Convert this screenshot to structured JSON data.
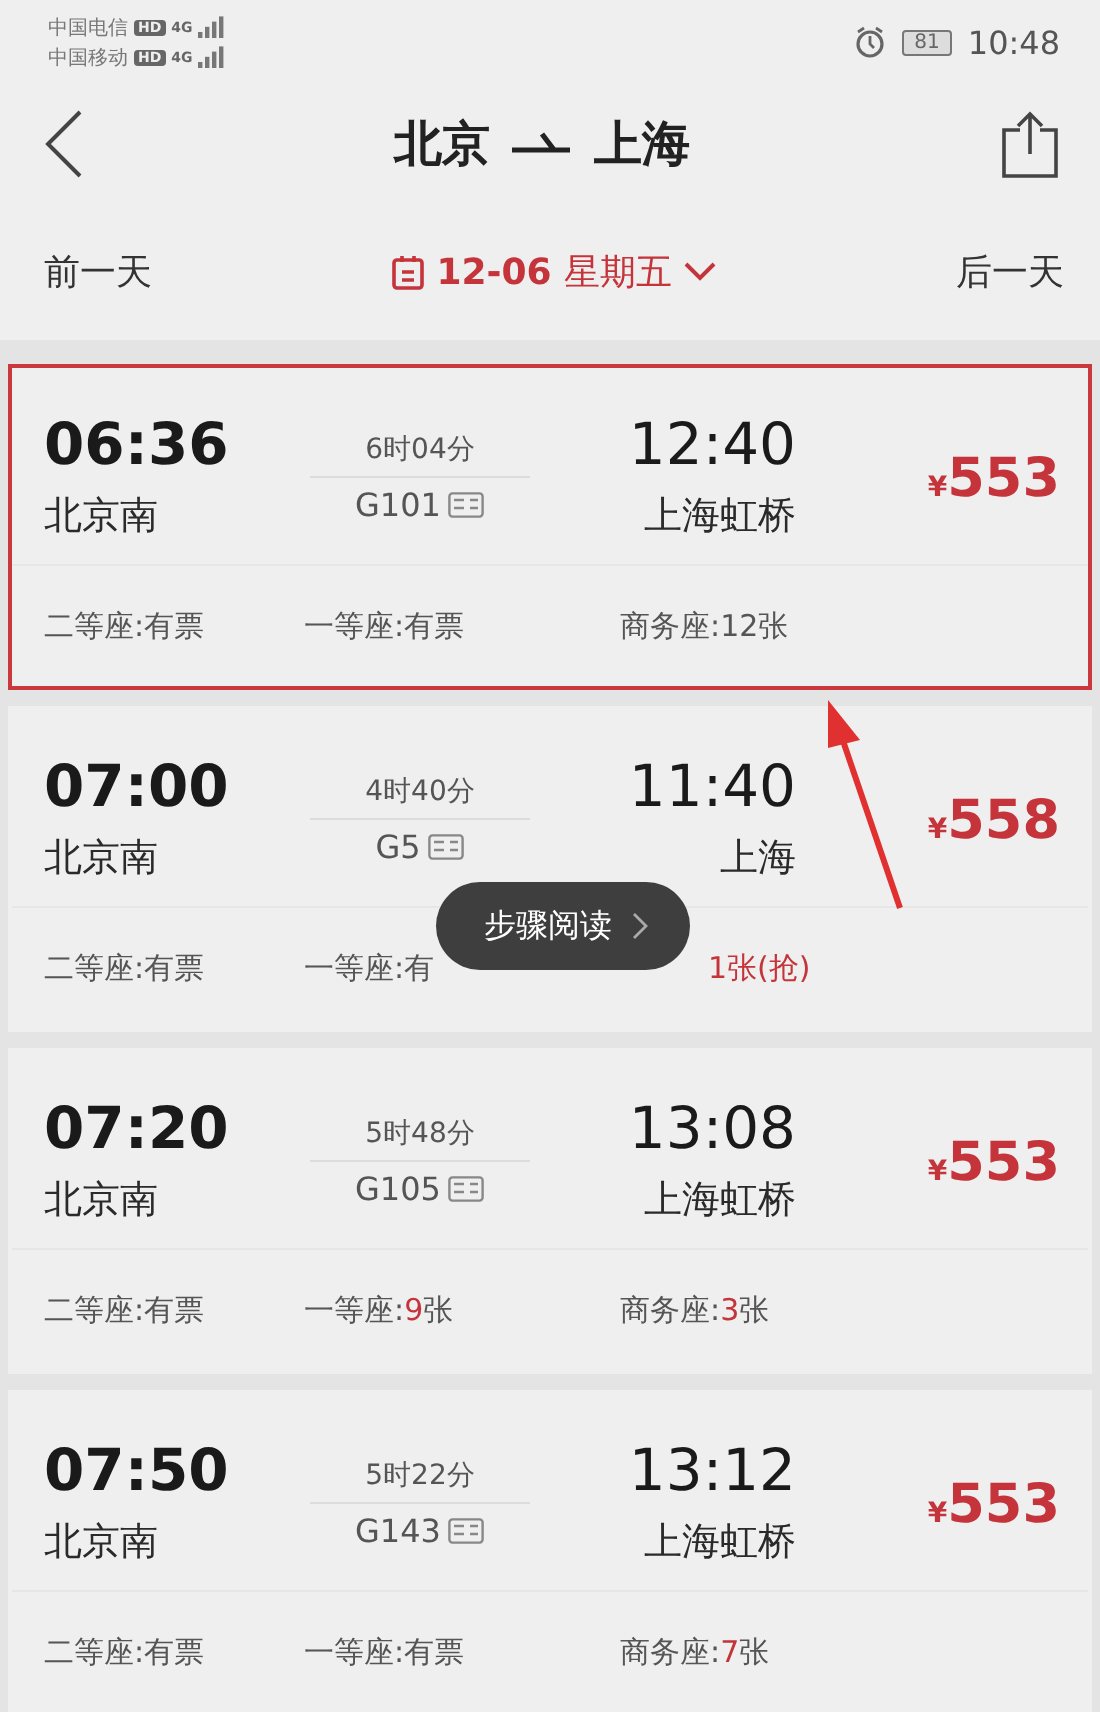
{
  "status_bar": {
    "carriers": [
      {
        "name": "中国电信",
        "badge": "HD",
        "network": "4G"
      },
      {
        "name": "中国移动",
        "badge": "HD",
        "network": "4G"
      }
    ],
    "battery": "81",
    "time": "10:48"
  },
  "header": {
    "from": "北京",
    "to": "上海"
  },
  "date_bar": {
    "prev": "前一天",
    "date": "12-06",
    "weekday": "星期五",
    "next": "后一天"
  },
  "trains": [
    {
      "depart": "06:36",
      "from": "北京南",
      "duration": "6时04分",
      "number": "G101",
      "arrive": "12:40",
      "to": "上海虹桥",
      "currency": "¥",
      "price": "553",
      "highlighted": true,
      "seats": [
        {
          "label": "二等座:",
          "count": "有票",
          "scarce": false
        },
        {
          "label": "一等座:",
          "count": "有票",
          "scarce": false
        },
        {
          "label": "商务座:",
          "count": "12张",
          "scarce": false
        }
      ]
    },
    {
      "depart": "07:00",
      "from": "北京南",
      "duration": "4时40分",
      "number": "G5",
      "arrive": "11:40",
      "to": "上海",
      "currency": "¥",
      "price": "558",
      "highlighted": false,
      "seats": [
        {
          "label": "二等座:",
          "count": "有票",
          "scarce": false
        },
        {
          "label": "一等座:有"
        },
        {
          "count": "1张(抢)",
          "scarce": true
        }
      ]
    },
    {
      "depart": "07:20",
      "from": "北京南",
      "duration": "5时48分",
      "number": "G105",
      "arrive": "13:08",
      "to": "上海虹桥",
      "currency": "¥",
      "price": "553",
      "highlighted": false,
      "seats": [
        {
          "label": "二等座:",
          "count": "有票",
          "scarce": false
        },
        {
          "label": "一等座:",
          "count": "9",
          "unit": "张",
          "scarce": true
        },
        {
          "label": "商务座:",
          "count": "3",
          "unit": "张",
          "scarce": true
        }
      ]
    },
    {
      "depart": "07:50",
      "from": "北京南",
      "duration": "5时22分",
      "number": "G143",
      "arrive": "13:12",
      "to": "上海虹桥",
      "currency": "¥",
      "price": "553",
      "highlighted": false,
      "seats": [
        {
          "label": "二等座:",
          "count": "有票",
          "scarce": false
        },
        {
          "label": "一等座:",
          "count": "有票",
          "scarce": false
        },
        {
          "label": "商务座:",
          "count": "7",
          "unit": "张",
          "scarce": true
        }
      ]
    }
  ],
  "overlay_button": {
    "label": "步骤阅读"
  }
}
